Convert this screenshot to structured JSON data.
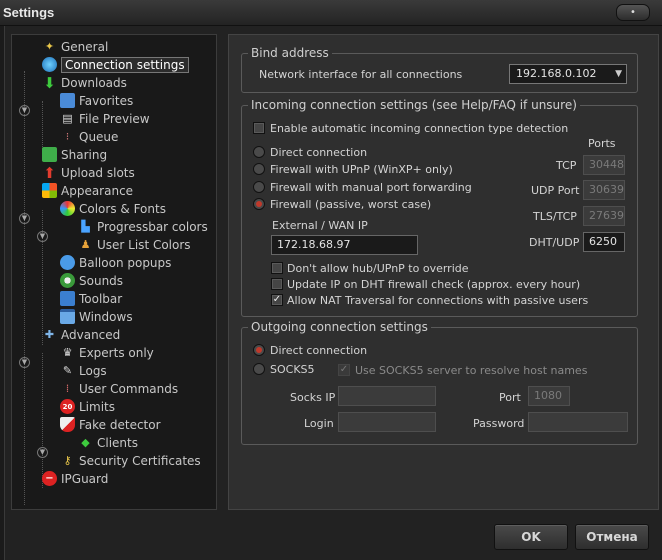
{
  "window": {
    "title": "Settings",
    "close_glyph": "•"
  },
  "tree": {
    "items": [
      {
        "label": "General",
        "icon": "wrench-icon"
      },
      {
        "label": "Connection settings",
        "icon": "globe-icon"
      },
      {
        "label": "Downloads",
        "icon": "download-arrow-icon"
      },
      {
        "label": "Favorites",
        "icon": "favorites-icon"
      },
      {
        "label": "File Preview",
        "icon": "clapper-icon"
      },
      {
        "label": "Queue",
        "icon": "queue-icon"
      },
      {
        "label": "Sharing",
        "icon": "sharing-icon"
      },
      {
        "label": "Upload slots",
        "icon": "upload-arrow-icon"
      },
      {
        "label": "Appearance",
        "icon": "windows-logo-icon"
      },
      {
        "label": "Colors & Fonts",
        "icon": "color-wheel-icon"
      },
      {
        "label": "Progressbar colors",
        "icon": "bars-icon"
      },
      {
        "label": "User List Colors",
        "icon": "users-icon"
      },
      {
        "label": "Balloon popups",
        "icon": "balloon-icon"
      },
      {
        "label": "Sounds",
        "icon": "speaker-icon"
      },
      {
        "label": "Toolbar",
        "icon": "toolbar-icon"
      },
      {
        "label": "Windows",
        "icon": "window-icon"
      },
      {
        "label": "Advanced",
        "icon": "tools-icon"
      },
      {
        "label": "Experts only",
        "icon": "expert-icon"
      },
      {
        "label": "Logs",
        "icon": "pen-icon"
      },
      {
        "label": "User Commands",
        "icon": "commands-icon"
      },
      {
        "label": "Limits",
        "icon": "speed-limit-icon"
      },
      {
        "label": "Fake detector",
        "icon": "shield-icon"
      },
      {
        "label": "Clients",
        "icon": "client-icon"
      },
      {
        "label": "Security Certificates",
        "icon": "key-icon"
      },
      {
        "label": "IPGuard",
        "icon": "stop-icon"
      }
    ]
  },
  "bind": {
    "title": "Bind address",
    "label": "Network interface for all connections",
    "value": "192.168.0.102"
  },
  "incoming": {
    "title": "Incoming connection settings (see Help/FAQ if unsure)",
    "auto_detect": "Enable automatic incoming connection type detection",
    "ports_header": "Ports",
    "modes": [
      {
        "label": "Direct connection",
        "selected": false
      },
      {
        "label": "Firewall with UPnP (WinXP+ only)",
        "selected": false
      },
      {
        "label": "Firewall with manual port forwarding",
        "selected": false
      },
      {
        "label": "Firewall (passive, worst case)",
        "selected": true
      }
    ],
    "wan_label": "External / WAN IP",
    "wan_value": "172.18.68.97",
    "ports": [
      {
        "label": "TCP",
        "value": "30448"
      },
      {
        "label": "UDP Port",
        "value": "30639"
      },
      {
        "label": "TLS/TCP",
        "value": "27639"
      },
      {
        "label": "DHT/UDP",
        "value": "6250"
      }
    ],
    "options": [
      {
        "label": "Don't allow hub/UPnP to override",
        "checked": false
      },
      {
        "label": "Update IP on DHT firewall check (approx. every hour)",
        "checked": false
      },
      {
        "label": "Allow NAT Traversal for connections with passive users",
        "checked": true
      }
    ]
  },
  "outgoing": {
    "title": "Outgoing connection settings",
    "direct": "Direct connection",
    "socks": "SOCKS5",
    "socks_resolve": "Use SOCKS5 server to resolve host names",
    "socks_ip_label": "Socks IP",
    "port_label": "Port",
    "port_value": "1080",
    "login_label": "Login",
    "password_label": "Password"
  },
  "buttons": {
    "ok": "OK",
    "cancel": "Отмена"
  },
  "colors": {
    "accent_radio": "#c0392b",
    "panel": "#2f2f2f",
    "tree_bg": "#191919"
  }
}
